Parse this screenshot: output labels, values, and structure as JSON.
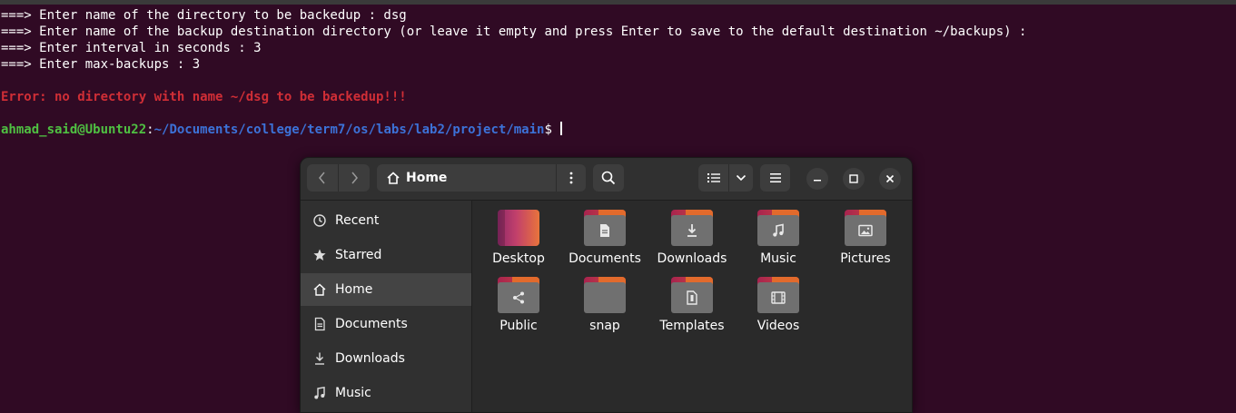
{
  "terminal": {
    "lines": [
      "===> Enter name of the directory to be backedup : dsg",
      "===> Enter name of the backup destination directory (or leave it empty and press Enter to save to the default destination ~/backups) :",
      "===> Enter interval in seconds : 3",
      "===> Enter max-backups : 3",
      "",
      "Error: no directory with name ~/dsg to be backedup!!!",
      ""
    ],
    "prompt_user": "ahmad_said@Ubuntu22",
    "prompt_colon": ":",
    "prompt_path": "~/Documents/college/term7/os/labs/lab2/project/main",
    "prompt_symbol": "$ ",
    "colors": {
      "background": "#300a24",
      "error": "#d02e36",
      "user": "#4fc042",
      "path": "#3c72d8"
    }
  },
  "file_manager": {
    "location": "Home",
    "icons": {
      "back": "chevron-left-icon",
      "forward": "chevron-right-icon",
      "home": "home-icon",
      "path_menu": "vertical-dots-icon",
      "search": "search-icon",
      "list_view": "list-view-icon",
      "view_options": "chevron-down-icon",
      "main_menu": "hamburger-menu-icon",
      "minimize": "minimize-icon",
      "maximize": "maximize-icon",
      "close": "close-icon"
    },
    "sidebar": [
      {
        "label": "Recent",
        "icon": "clock-icon"
      },
      {
        "label": "Starred",
        "icon": "star-icon"
      },
      {
        "label": "Home",
        "icon": "home-icon",
        "active": true
      },
      {
        "label": "Documents",
        "icon": "document-icon"
      },
      {
        "label": "Downloads",
        "icon": "download-icon"
      },
      {
        "label": "Music",
        "icon": "music-icon"
      }
    ],
    "files": [
      {
        "label": "Desktop",
        "icon": "desktop-folder-icon"
      },
      {
        "label": "Documents",
        "icon": "documents-folder-icon"
      },
      {
        "label": "Downloads",
        "icon": "downloads-folder-icon"
      },
      {
        "label": "Music",
        "icon": "music-folder-icon"
      },
      {
        "label": "Pictures",
        "icon": "pictures-folder-icon"
      },
      {
        "label": "Public",
        "icon": "public-folder-icon"
      },
      {
        "label": "snap",
        "icon": "folder-icon"
      },
      {
        "label": "Templates",
        "icon": "templates-folder-icon"
      },
      {
        "label": "Videos",
        "icon": "videos-folder-icon"
      }
    ]
  }
}
